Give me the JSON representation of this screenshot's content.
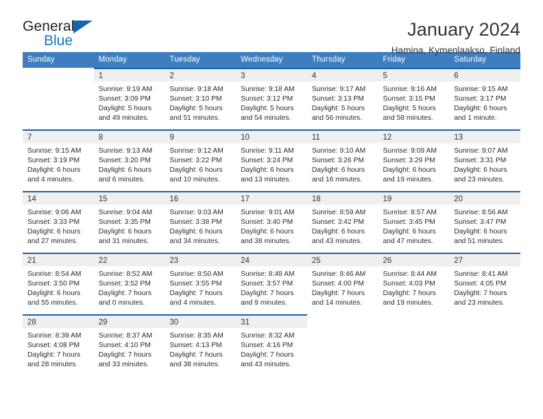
{
  "brand": {
    "name_top": "General",
    "name_bottom": "Blue",
    "triangle_color": "#1565ac",
    "blue_color": "#1277c4"
  },
  "header": {
    "title": "January 2024",
    "subtitle": "Hamina, Kymenlaakso, Finland"
  },
  "theme": {
    "header_row_bg": "#3c7ebf",
    "row_rule": "#1f5f9e",
    "daynum_bg": "#efefef"
  },
  "weekdays": [
    "Sunday",
    "Monday",
    "Tuesday",
    "Wednesday",
    "Thursday",
    "Friday",
    "Saturday"
  ],
  "labels": {
    "sunrise_prefix": "Sunrise:",
    "sunset_prefix": "Sunset:",
    "daylight_prefix": "Daylight:"
  },
  "weeks": [
    [
      {
        "empty": true
      },
      {
        "day": "1",
        "sunrise": "Sunrise: 9:19 AM",
        "sunset": "Sunset: 3:09 PM",
        "daylight1": "Daylight: 5 hours",
        "daylight2": "and 49 minutes."
      },
      {
        "day": "2",
        "sunrise": "Sunrise: 9:18 AM",
        "sunset": "Sunset: 3:10 PM",
        "daylight1": "Daylight: 5 hours",
        "daylight2": "and 51 minutes."
      },
      {
        "day": "3",
        "sunrise": "Sunrise: 9:18 AM",
        "sunset": "Sunset: 3:12 PM",
        "daylight1": "Daylight: 5 hours",
        "daylight2": "and 54 minutes."
      },
      {
        "day": "4",
        "sunrise": "Sunrise: 9:17 AM",
        "sunset": "Sunset: 3:13 PM",
        "daylight1": "Daylight: 5 hours",
        "daylight2": "and 56 minutes."
      },
      {
        "day": "5",
        "sunrise": "Sunrise: 9:16 AM",
        "sunset": "Sunset: 3:15 PM",
        "daylight1": "Daylight: 5 hours",
        "daylight2": "and 58 minutes."
      },
      {
        "day": "6",
        "sunrise": "Sunrise: 9:15 AM",
        "sunset": "Sunset: 3:17 PM",
        "daylight1": "Daylight: 6 hours",
        "daylight2": "and 1 minute."
      }
    ],
    [
      {
        "day": "7",
        "sunrise": "Sunrise: 9:15 AM",
        "sunset": "Sunset: 3:19 PM",
        "daylight1": "Daylight: 6 hours",
        "daylight2": "and 4 minutes."
      },
      {
        "day": "8",
        "sunrise": "Sunrise: 9:13 AM",
        "sunset": "Sunset: 3:20 PM",
        "daylight1": "Daylight: 6 hours",
        "daylight2": "and 6 minutes."
      },
      {
        "day": "9",
        "sunrise": "Sunrise: 9:12 AM",
        "sunset": "Sunset: 3:22 PM",
        "daylight1": "Daylight: 6 hours",
        "daylight2": "and 10 minutes."
      },
      {
        "day": "10",
        "sunrise": "Sunrise: 9:11 AM",
        "sunset": "Sunset: 3:24 PM",
        "daylight1": "Daylight: 6 hours",
        "daylight2": "and 13 minutes."
      },
      {
        "day": "11",
        "sunrise": "Sunrise: 9:10 AM",
        "sunset": "Sunset: 3:26 PM",
        "daylight1": "Daylight: 6 hours",
        "daylight2": "and 16 minutes."
      },
      {
        "day": "12",
        "sunrise": "Sunrise: 9:09 AM",
        "sunset": "Sunset: 3:29 PM",
        "daylight1": "Daylight: 6 hours",
        "daylight2": "and 19 minutes."
      },
      {
        "day": "13",
        "sunrise": "Sunrise: 9:07 AM",
        "sunset": "Sunset: 3:31 PM",
        "daylight1": "Daylight: 6 hours",
        "daylight2": "and 23 minutes."
      }
    ],
    [
      {
        "day": "14",
        "sunrise": "Sunrise: 9:06 AM",
        "sunset": "Sunset: 3:33 PM",
        "daylight1": "Daylight: 6 hours",
        "daylight2": "and 27 minutes."
      },
      {
        "day": "15",
        "sunrise": "Sunrise: 9:04 AM",
        "sunset": "Sunset: 3:35 PM",
        "daylight1": "Daylight: 6 hours",
        "daylight2": "and 31 minutes."
      },
      {
        "day": "16",
        "sunrise": "Sunrise: 9:03 AM",
        "sunset": "Sunset: 3:38 PM",
        "daylight1": "Daylight: 6 hours",
        "daylight2": "and 34 minutes."
      },
      {
        "day": "17",
        "sunrise": "Sunrise: 9:01 AM",
        "sunset": "Sunset: 3:40 PM",
        "daylight1": "Daylight: 6 hours",
        "daylight2": "and 38 minutes."
      },
      {
        "day": "18",
        "sunrise": "Sunrise: 8:59 AM",
        "sunset": "Sunset: 3:42 PM",
        "daylight1": "Daylight: 6 hours",
        "daylight2": "and 43 minutes."
      },
      {
        "day": "19",
        "sunrise": "Sunrise: 8:57 AM",
        "sunset": "Sunset: 3:45 PM",
        "daylight1": "Daylight: 6 hours",
        "daylight2": "and 47 minutes."
      },
      {
        "day": "20",
        "sunrise": "Sunrise: 8:56 AM",
        "sunset": "Sunset: 3:47 PM",
        "daylight1": "Daylight: 6 hours",
        "daylight2": "and 51 minutes."
      }
    ],
    [
      {
        "day": "21",
        "sunrise": "Sunrise: 8:54 AM",
        "sunset": "Sunset: 3:50 PM",
        "daylight1": "Daylight: 6 hours",
        "daylight2": "and 55 minutes."
      },
      {
        "day": "22",
        "sunrise": "Sunrise: 8:52 AM",
        "sunset": "Sunset: 3:52 PM",
        "daylight1": "Daylight: 7 hours",
        "daylight2": "and 0 minutes."
      },
      {
        "day": "23",
        "sunrise": "Sunrise: 8:50 AM",
        "sunset": "Sunset: 3:55 PM",
        "daylight1": "Daylight: 7 hours",
        "daylight2": "and 4 minutes."
      },
      {
        "day": "24",
        "sunrise": "Sunrise: 8:48 AM",
        "sunset": "Sunset: 3:57 PM",
        "daylight1": "Daylight: 7 hours",
        "daylight2": "and 9 minutes."
      },
      {
        "day": "25",
        "sunrise": "Sunrise: 8:46 AM",
        "sunset": "Sunset: 4:00 PM",
        "daylight1": "Daylight: 7 hours",
        "daylight2": "and 14 minutes."
      },
      {
        "day": "26",
        "sunrise": "Sunrise: 8:44 AM",
        "sunset": "Sunset: 4:03 PM",
        "daylight1": "Daylight: 7 hours",
        "daylight2": "and 19 minutes."
      },
      {
        "day": "27",
        "sunrise": "Sunrise: 8:41 AM",
        "sunset": "Sunset: 4:05 PM",
        "daylight1": "Daylight: 7 hours",
        "daylight2": "and 23 minutes."
      }
    ],
    [
      {
        "day": "28",
        "sunrise": "Sunrise: 8:39 AM",
        "sunset": "Sunset: 4:08 PM",
        "daylight1": "Daylight: 7 hours",
        "daylight2": "and 28 minutes."
      },
      {
        "day": "29",
        "sunrise": "Sunrise: 8:37 AM",
        "sunset": "Sunset: 4:10 PM",
        "daylight1": "Daylight: 7 hours",
        "daylight2": "and 33 minutes."
      },
      {
        "day": "30",
        "sunrise": "Sunrise: 8:35 AM",
        "sunset": "Sunset: 4:13 PM",
        "daylight1": "Daylight: 7 hours",
        "daylight2": "and 38 minutes."
      },
      {
        "day": "31",
        "sunrise": "Sunrise: 8:32 AM",
        "sunset": "Sunset: 4:16 PM",
        "daylight1": "Daylight: 7 hours",
        "daylight2": "and 43 minutes."
      },
      {
        "empty": true
      },
      {
        "empty": true
      },
      {
        "empty": true
      }
    ]
  ]
}
